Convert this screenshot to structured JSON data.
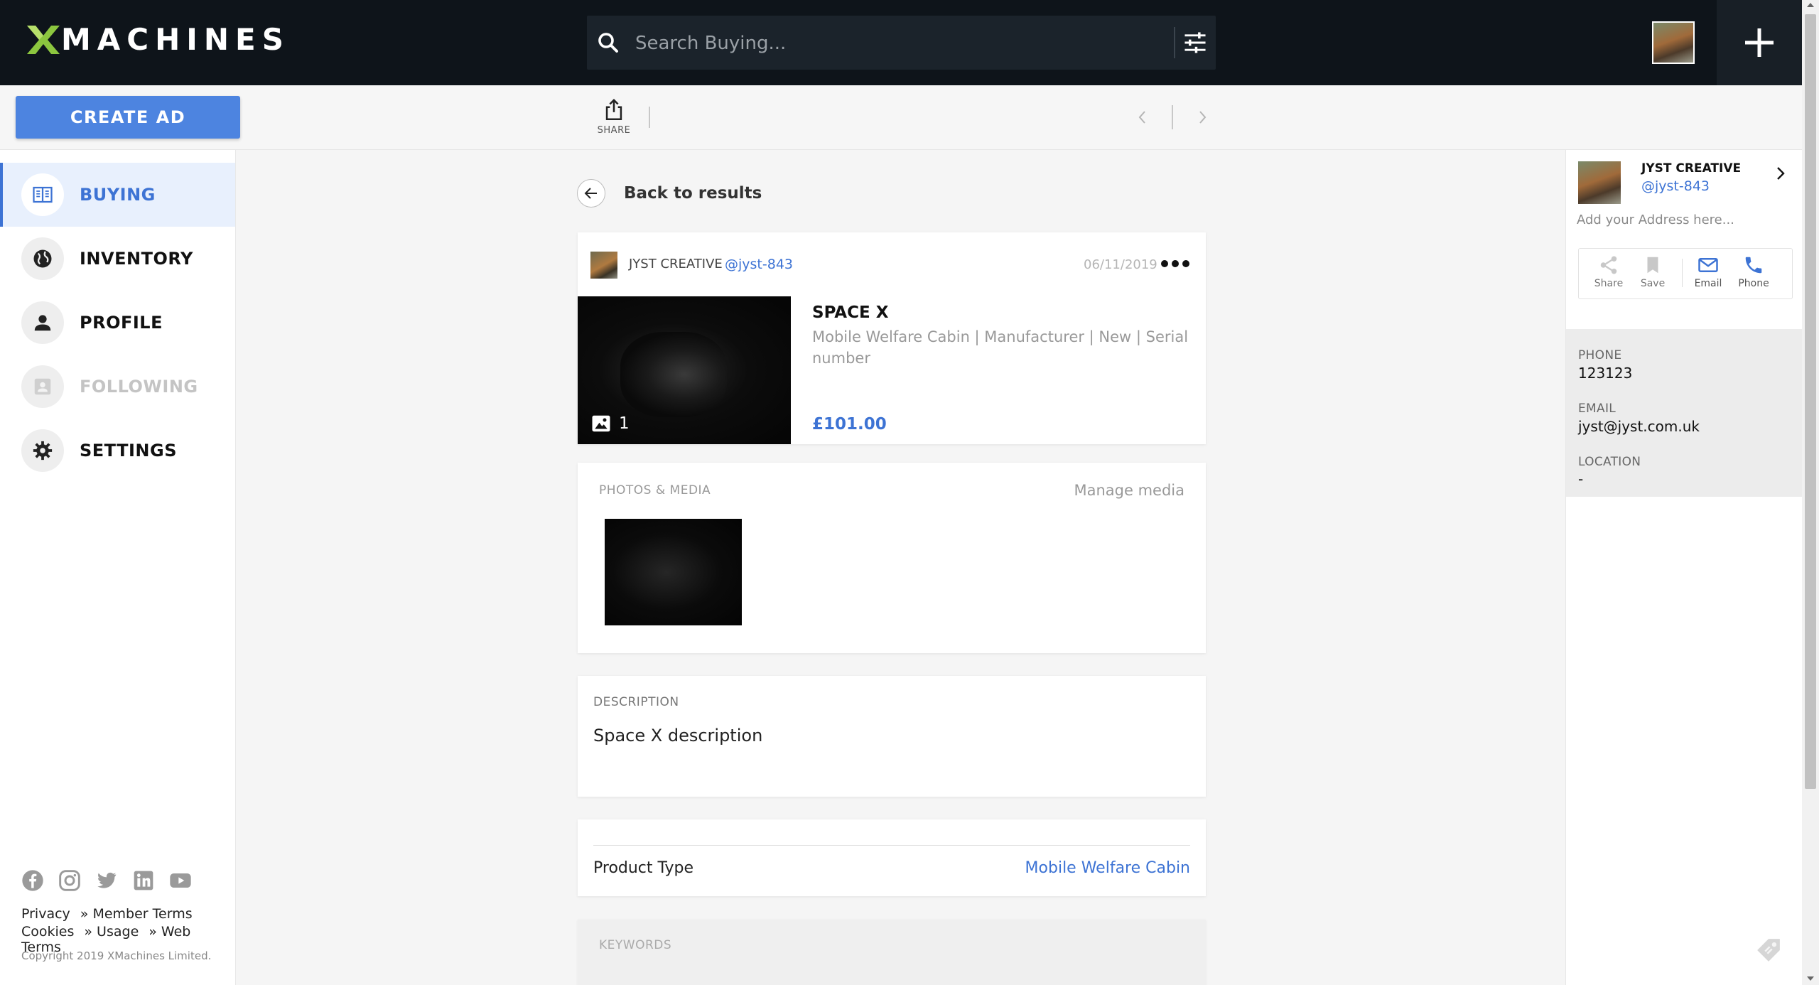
{
  "app": {
    "logo_text": "MACHINES"
  },
  "search": {
    "placeholder": "Search Buying..."
  },
  "toolbar": {
    "create_ad_label": "CREATE AD",
    "share_label": "SHARE"
  },
  "sidebar": {
    "items": [
      {
        "label": "BUYING",
        "icon": "book-icon",
        "state": "active"
      },
      {
        "label": "INVENTORY",
        "icon": "globe-icon",
        "state": "normal"
      },
      {
        "label": "PROFILE",
        "icon": "person-icon",
        "state": "normal"
      },
      {
        "label": "FOLLOWING",
        "icon": "contacts-icon",
        "state": "disabled"
      },
      {
        "label": "SETTINGS",
        "icon": "gear-icon",
        "state": "normal"
      }
    ],
    "social": [
      "facebook-icon",
      "instagram-icon",
      "twitter-icon",
      "linkedin-icon",
      "youtube-icon"
    ],
    "legal_row1": [
      "Privacy",
      "» Member Terms"
    ],
    "legal_row2": [
      "Cookies",
      "» Usage",
      "» Web Terms"
    ],
    "copyright": "Copyright 2019 XMachines Limited."
  },
  "main": {
    "back_label": "Back to results",
    "listing": {
      "seller_name": "JYST CREATIVE",
      "seller_handle": "@jyst-843",
      "date": "06/11/2019",
      "photo_count": "1",
      "title": "SPACE X",
      "meta": "Mobile Welfare Cabin | Manufacturer | New | Serial number",
      "price": "£101.00"
    },
    "media": {
      "header": "PHOTOS & MEDIA",
      "manage_label": "Manage media"
    },
    "description": {
      "header": "DESCRIPTION",
      "text": "Space X description"
    },
    "product_type": {
      "label": "Product Type",
      "value": "Mobile Welfare Cabin"
    },
    "keywords": {
      "header": "KEYWORDS"
    }
  },
  "right_panel": {
    "name": "JYST CREATIVE",
    "handle": "@jyst-843",
    "address_placeholder": "Add your Address here...",
    "actions": [
      {
        "label": "Share",
        "icon": "share-icon"
      },
      {
        "label": "Save",
        "icon": "bookmark-icon"
      },
      {
        "label": "Email",
        "icon": "mail-icon"
      },
      {
        "label": "Phone",
        "icon": "phone-icon"
      }
    ],
    "info": {
      "phone_label": "PHONE",
      "phone": "123123",
      "email_label": "EMAIL",
      "email": "jyst@jyst.com.uk",
      "location_label": "LOCATION",
      "location": "-"
    }
  },
  "colors": {
    "accent": "#3d73d4",
    "button": "#4d84e0",
    "topbar": "#0e141a",
    "logo_x": "#8cc63f"
  }
}
